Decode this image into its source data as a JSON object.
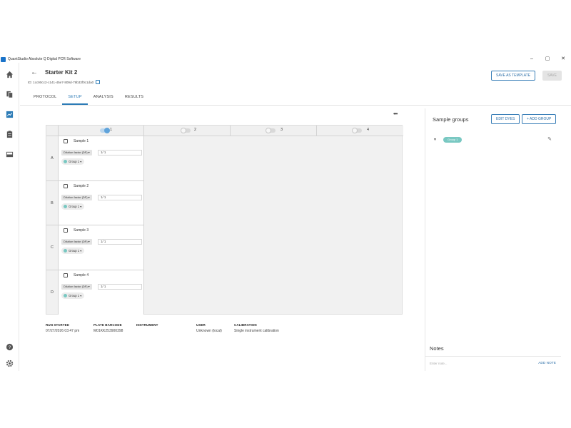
{
  "window": {
    "title": "QuantStudio Absolute Q Digital PCR Software",
    "controls": [
      "–",
      "▢",
      "✕"
    ]
  },
  "rail": {
    "icons": [
      "home-icon",
      "files-icon",
      "chart-icon",
      "clipboard-icon",
      "storage-icon",
      "help-icon",
      "settings-icon"
    ]
  },
  "header": {
    "title": "Starter Kit 2",
    "id": "ID: 1cc90cc2-c141-45e7-809d-79b33f0c1da0",
    "save_template": "SAVE AS TEMPLATE",
    "save": "SAVE",
    "tabs": [
      "PROTOCOL",
      "SETUP",
      "ANALYSIS",
      "RESULTS"
    ],
    "active_tab": "SETUP"
  },
  "plate": {
    "columns": [
      {
        "label": "1",
        "enabled": true
      },
      {
        "label": "2",
        "enabled": false
      },
      {
        "label": "3",
        "enabled": false
      },
      {
        "label": "4",
        "enabled": false
      }
    ],
    "rows": [
      "A",
      "B",
      "C",
      "D"
    ],
    "wells": [
      {
        "sample": "Sample 1",
        "df_label": "Dilution factor (DF) ▾",
        "df_value": "1/ 1",
        "group": "Group 1 ▾"
      },
      {
        "sample": "Sample 2",
        "df_label": "Dilution factor (DF) ▾",
        "df_value": "1/ 1",
        "group": "Group 1 ▾"
      },
      {
        "sample": "Sample 3",
        "df_label": "Dilution factor (DF) ▾",
        "df_value": "1/ 1",
        "group": "Group 1 ▾"
      },
      {
        "sample": "Sample 4",
        "df_label": "Dilution factor (DF) ▾",
        "df_value": "1/ 1",
        "group": "Group 1 ▾"
      }
    ]
  },
  "run_info": {
    "run_started": {
      "label": "RUN STARTED",
      "value": "07/27/2026 03:47 pm"
    },
    "plate_barcode": {
      "label": "PLATE BARCODE",
      "value": "M01KK253900398"
    },
    "instrument": {
      "label": "INSTRUMENT",
      "value": ""
    },
    "user": {
      "label": "USER",
      "value": "Unknown (local)"
    },
    "calibration": {
      "label": "CALIBRATION",
      "value": "Single instrument calibration"
    }
  },
  "sample_groups": {
    "title": "Sample groups",
    "edit_dyes": "EDIT DYES",
    "add_group": "+ ADD GROUP",
    "group": "Group 1",
    "group_color": "#79c8c2"
  },
  "notes": {
    "title": "Notes",
    "placeholder": "Enter note...",
    "add": "ADD NOTE"
  },
  "colors": {
    "accent": "#2c7bb6"
  }
}
